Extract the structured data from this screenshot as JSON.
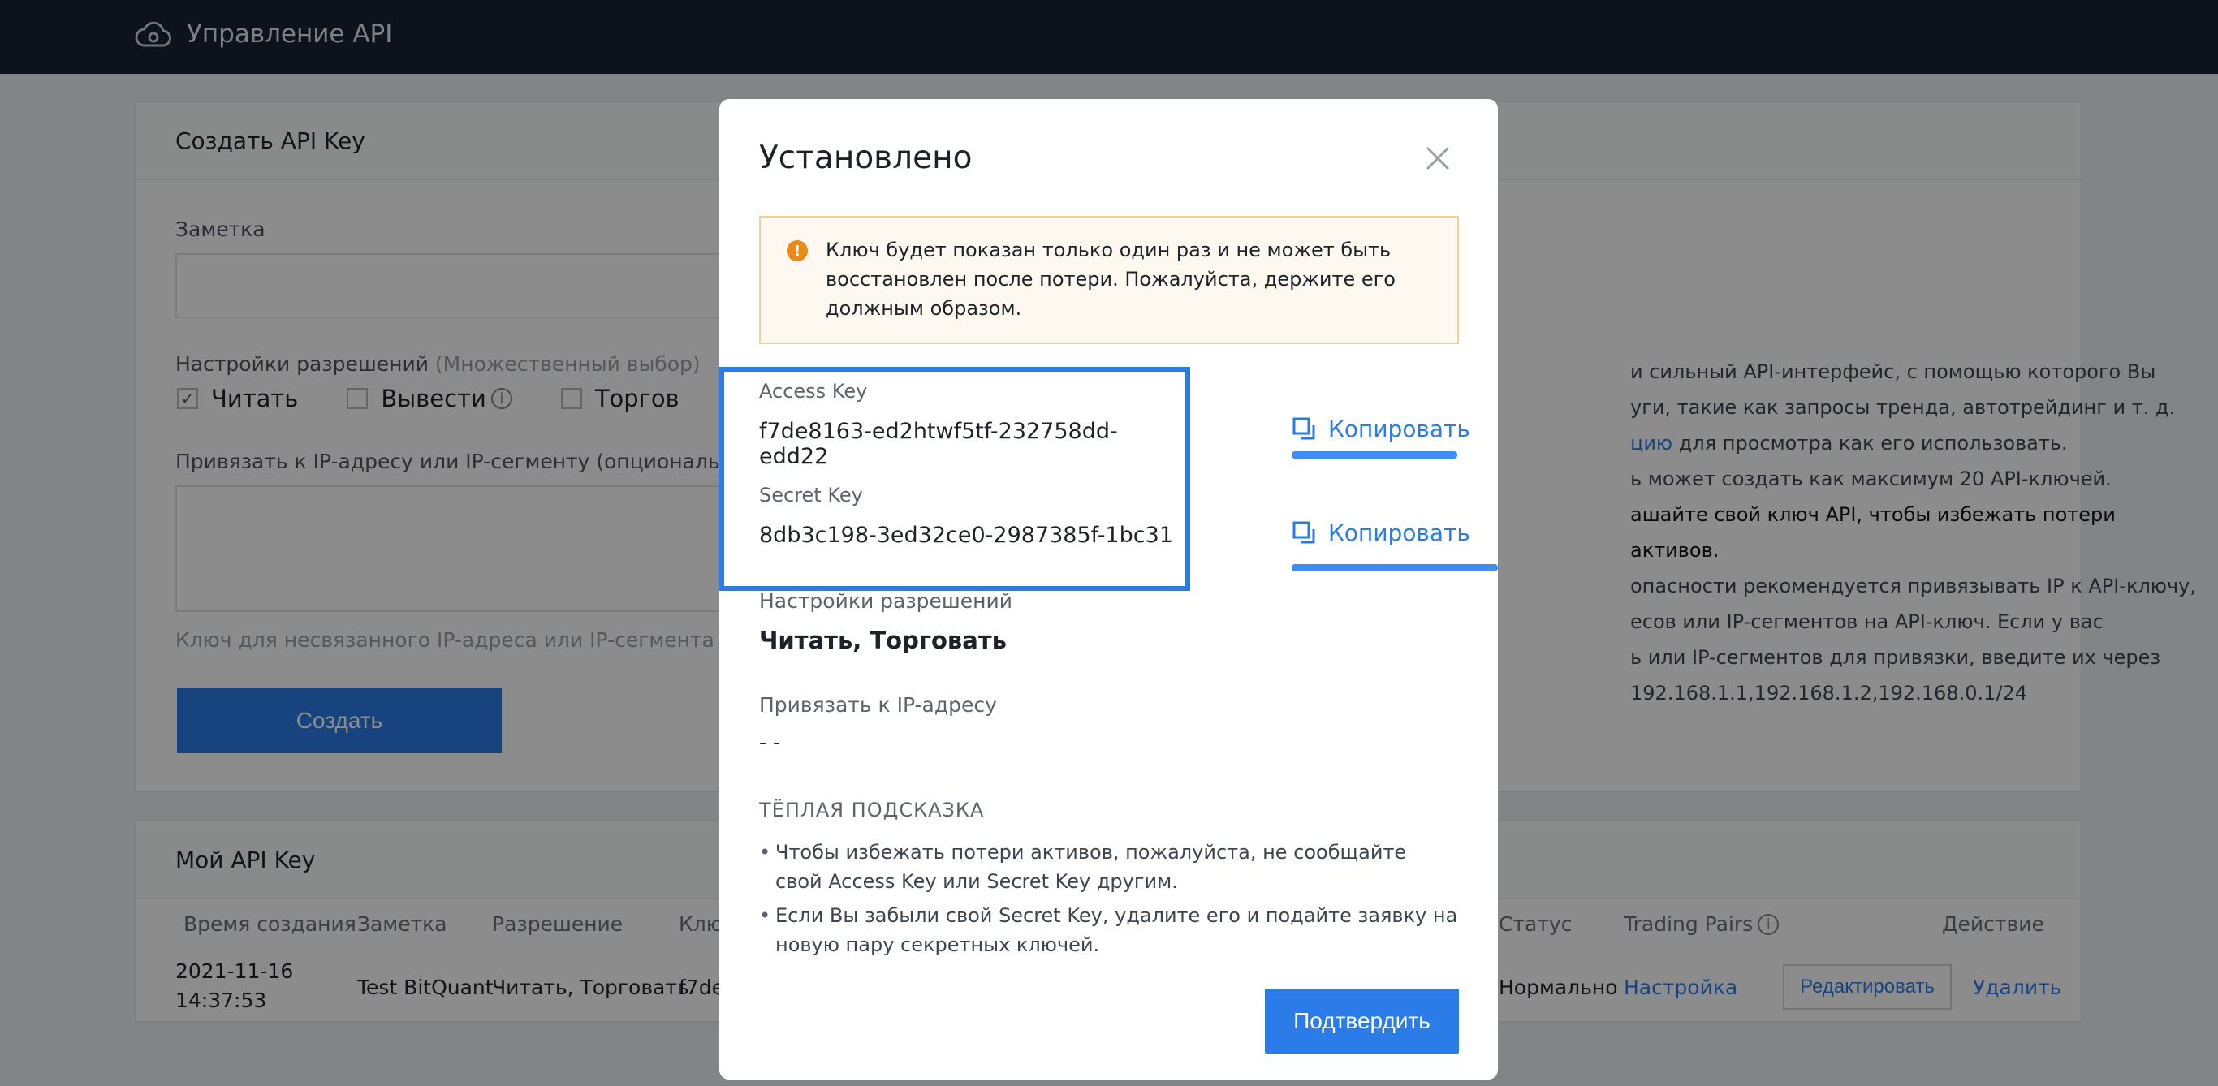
{
  "header": {
    "title": "Управление API",
    "logo_icon": "cloud-icon"
  },
  "create_card": {
    "title": "Создать API Key",
    "note_label": "Заметка",
    "permissions_label": "Настройки разрешений",
    "permissions_hint": "(Множественный выбор)",
    "permissions": [
      {
        "label": "Читать",
        "checked": true
      },
      {
        "label": "Вывести",
        "checked": false
      },
      {
        "label": "Торгов",
        "checked": false
      }
    ],
    "ip_label": "Привязать к IP-адресу или IP-сегменту (опционально)",
    "ip_note": "Ключ для несвязанного IP-адреса или IP-сегмента дейст",
    "create_button": "Создать",
    "info": {
      "line1": "и сильный API-интерфейс, с помощью которого Вы",
      "line2": "уги, такие как запросы тренда, автотрейдинг и т. д.",
      "line3_link": "цию",
      "line3_rest": " для просмотра как его использовать.",
      "line4": "ь может создать как максимум 20 API-ключей.",
      "line5": "ашайте свой ключ API, чтобы избежать потери активов.",
      "line6": "опасности рекомендуется привязывать IP к API-ключу,",
      "line7": "есов или IP-сегментов на API-ключ. Если у вас",
      "line8": "ь или IP-сегментов для привязки, введите их через",
      "line9": "192.168.1.1,192.168.1.2,192.168.0.1/24"
    }
  },
  "keys_card": {
    "title": "Мой API Key",
    "columns": [
      "Время создания",
      "Заметка",
      "Разрешение",
      "Клю",
      "Статус",
      "Trading Pairs",
      "Действие"
    ],
    "row": {
      "created_date": "2021-11-16",
      "created_time": "14:37:53",
      "note": "Test BitQuant",
      "permission": "Читать, Торговать",
      "key": "f7de",
      "status": "Нормально",
      "settings_link": "Настройка",
      "edit_button": "Редактировать",
      "delete_link": "Удалить"
    }
  },
  "modal": {
    "title": "Установлено",
    "warning": "Ключ будет показан только один раз и не может быть восстановлен после потери. Пожалуйста, держите его должным образом.",
    "access_key_label": "Access Key",
    "access_key_value": "f7de8163-ed2htwf5tf-232758dd-edd22",
    "secret_key_label": "Secret Key",
    "secret_key_value": "8db3c198-3ed32ce0-2987385f-1bc31",
    "copy_label": "Копировать",
    "permissions_label": "Настройки разрешений",
    "permissions_value": "Читать, Торговать",
    "ip_label": "Привязать к IP-адресу",
    "ip_value": "- -",
    "hint_title": "ТЁПЛАЯ ПОДСКАЗКА",
    "hints": [
      "Чтобы избежать потери активов, пожалуйста, не сообщайте свой Access Key или Secret Key другим.",
      "Если Вы забыли свой Secret Key, удалите его и подайте заявку на новую пару секретных ключей."
    ],
    "confirm_button": "Подтвердить"
  },
  "colors": {
    "accent": "#2b7be8",
    "topbar": "#1b2236",
    "warning": "#ec8a18"
  }
}
